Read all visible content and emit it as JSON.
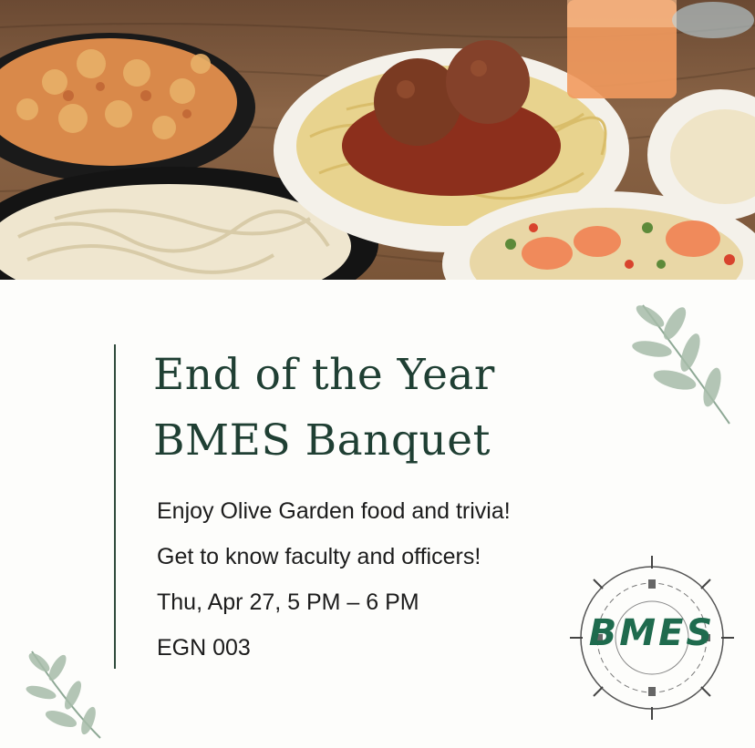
{
  "photo": {
    "alt_icon": "pasta-dishes-photo"
  },
  "event": {
    "title_line1": "End of the Year",
    "title_line2": "BMES  Banquet",
    "details": [
      "Enjoy Olive Garden food and trivia!",
      "Get to know faculty and officers!",
      "Thu, Apr 27, 5 PM – 6 PM",
      "EGN 003"
    ]
  },
  "logo": {
    "text": "BMES"
  },
  "colors": {
    "title": "#1f3f33",
    "accent": "#1f6b4e",
    "leaf": "#8ea895"
  }
}
